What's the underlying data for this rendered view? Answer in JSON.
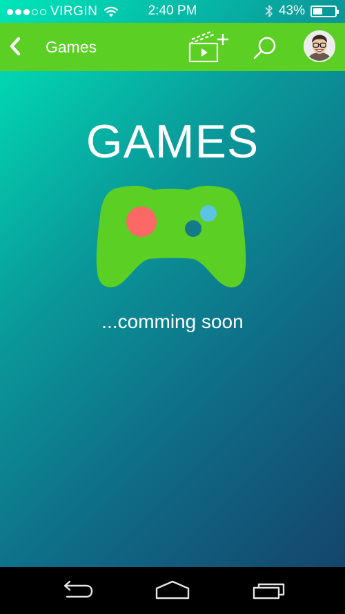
{
  "status_bar": {
    "carrier": "VIRGIN",
    "signal_strength": 3,
    "signal_max": 5,
    "time": "2:40 PM",
    "battery_text": "43%",
    "battery_level": 0.43
  },
  "header": {
    "title": "Games",
    "back_icon": "chevron-left-icon",
    "add_video_icon": "clapperboard-plus-icon",
    "search_icon": "search-icon"
  },
  "main": {
    "title": "GAMES",
    "subtitle": "...comming soon",
    "icon": "gamepad-icon"
  },
  "nav": {
    "back_icon": "back-arrow-icon",
    "home_icon": "home-icon",
    "recent_icon": "recent-apps-icon"
  },
  "colors": {
    "accent_green": "#5bcf24",
    "gradient_start": "#00e6b8",
    "gradient_end": "#153f67",
    "button_red": "#fb6866",
    "button_blue": "#5bc4e0",
    "button_teal": "#137a8a"
  }
}
